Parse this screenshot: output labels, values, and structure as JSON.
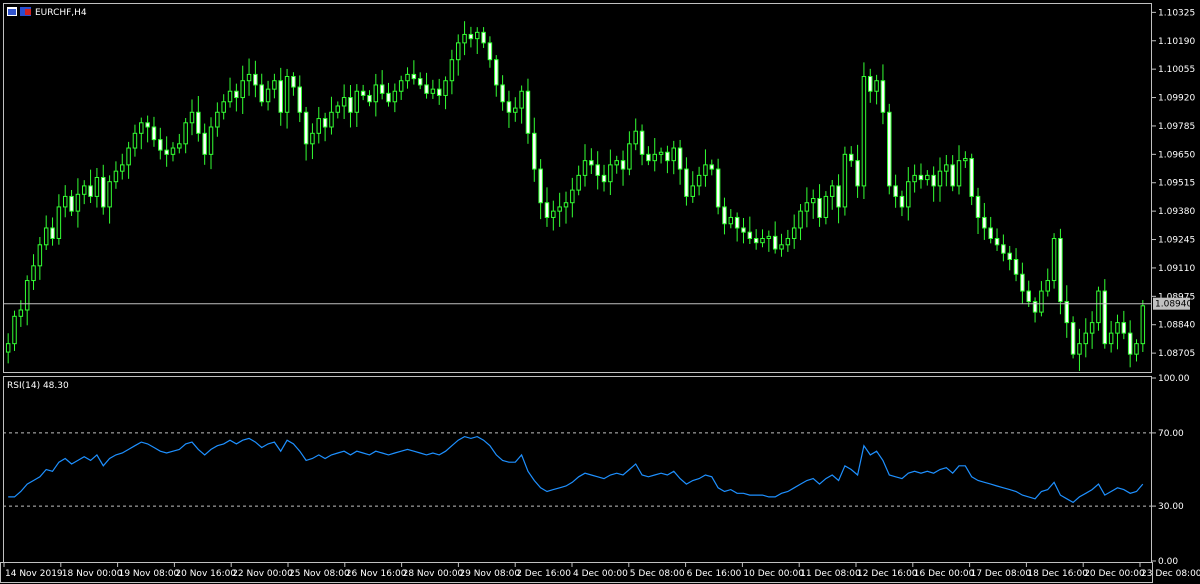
{
  "window": {
    "title": "EURCHF,H4",
    "icon_names": [
      "chart-window-icon",
      "eu-ch-flag-icon"
    ]
  },
  "colors": {
    "background": "#000000",
    "frame": "#c0c0c0",
    "candle_bull": "#ffffff",
    "candle_bear": "#33ff33",
    "wick": "#33ff33",
    "rsi_line": "#1e90ff",
    "current_price_line": "#c0c0c0",
    "level_line": "#c0c0c0"
  },
  "chart_data": [
    {
      "type": "candlestick",
      "symbol": "EURCHF",
      "timeframe": "H4",
      "title": "EURCHF,H4",
      "price_axis_ticks": [
        "1.10325",
        "1.10190",
        "1.10055",
        "1.09920",
        "1.09785",
        "1.09650",
        "1.09515",
        "1.09380",
        "1.09245",
        "1.09110",
        "1.08975",
        "1.08840",
        "1.08705"
      ],
      "current_price": "1.08940",
      "ylim": [
        1.0862,
        1.1036
      ],
      "time_axis_labels": [
        "14 Nov 2019",
        "18 Nov 00:00",
        "19 Nov 08:00",
        "20 Nov 16:00",
        "22 Nov 00:00",
        "25 Nov 08:00",
        "26 Nov 16:00",
        "28 Nov 00:00",
        "29 Nov 08:00",
        "2 Dec 16:00",
        "4 Dec 00:00",
        "5 Dec 08:00",
        "6 Dec 16:00",
        "10 Dec 00:00",
        "11 Dec 08:00",
        "12 Dec 16:00",
        "16 Dec 00:00",
        "17 Dec 08:00",
        "18 Dec 16:00",
        "20 Dec 00:00",
        "23 Dec 08:00"
      ],
      "close": [
        1.0875,
        1.0888,
        1.0891,
        1.0905,
        1.0912,
        1.0922,
        1.093,
        1.0925,
        1.094,
        1.0945,
        1.0938,
        1.0946,
        1.095,
        1.0945,
        1.0954,
        1.094,
        1.0952,
        1.0957,
        1.096,
        1.0968,
        1.0975,
        1.098,
        1.0978,
        1.0972,
        1.0967,
        1.0965,
        1.0968,
        1.097,
        1.098,
        1.0985,
        1.0975,
        1.0965,
        1.0978,
        1.0985,
        1.099,
        1.0995,
        1.0992,
        1.1,
        1.1003,
        1.0998,
        1.099,
        1.0996,
        1.1,
        1.0985,
        1.1002,
        1.0997,
        1.0985,
        1.097,
        1.0975,
        1.0982,
        1.0978,
        1.0985,
        1.0988,
        1.0992,
        1.0985,
        1.0995,
        1.0993,
        1.099,
        1.0998,
        1.0994,
        1.099,
        1.0995,
        1.1,
        1.1003,
        1.1001,
        1.0998,
        1.0994,
        1.0996,
        1.0993,
        1.1,
        1.101,
        1.1018,
        1.1022,
        1.102,
        1.1023,
        1.1018,
        1.101,
        1.0998,
        1.099,
        1.0985,
        1.0987,
        1.0995,
        1.0975,
        1.0958,
        1.0942,
        1.0935,
        1.0938,
        1.094,
        1.0942,
        1.0948,
        1.0955,
        1.0962,
        1.096,
        1.0955,
        1.0952,
        1.096,
        1.0962,
        1.0958,
        1.097,
        1.0976,
        1.0965,
        1.0962,
        1.0965,
        1.0966,
        1.0962,
        1.0968,
        1.0958,
        1.0945,
        1.095,
        1.0955,
        1.096,
        1.0958,
        1.094,
        1.0932,
        1.0935,
        1.093,
        1.0928,
        1.0925,
        1.0923,
        1.0925,
        1.0926,
        1.092,
        1.0922,
        1.0925,
        1.093,
        1.0938,
        1.0942,
        1.0944,
        1.0935,
        1.0945,
        1.095,
        1.094,
        1.0965,
        1.0962,
        1.095,
        1.1002,
        1.0995,
        1.1,
        1.0985,
        1.095,
        1.0945,
        1.094,
        1.0952,
        1.0955,
        1.0953,
        1.0955,
        1.095,
        1.0957,
        1.096,
        1.095,
        1.0962,
        1.0963,
        1.0945,
        1.0935,
        1.093,
        1.0925,
        1.0922,
        1.0918,
        1.0915,
        1.0908,
        1.09,
        1.0895,
        1.089,
        1.09,
        1.0905,
        1.0925,
        1.0895,
        1.0885,
        1.087,
        1.0875,
        1.088,
        1.0885,
        1.09,
        1.0875,
        1.088,
        1.0885,
        1.088,
        1.087,
        1.0875,
        1.0893
      ],
      "rsi": {
        "label": "RSI(14) 48.30",
        "period": 14,
        "last_value": 48.3,
        "axis_ticks": [
          "100.00",
          "70.00",
          "30.00",
          "0.00"
        ],
        "levels": [
          70,
          30
        ],
        "ylim": [
          0,
          100
        ],
        "values": [
          35,
          35,
          38,
          42,
          44,
          46,
          50,
          49,
          54,
          56,
          53,
          55,
          57,
          55,
          58,
          52,
          56,
          58,
          59,
          61,
          63,
          65,
          64,
          62,
          60,
          59,
          60,
          61,
          64,
          65,
          61,
          58,
          61,
          63,
          64,
          66,
          64,
          66,
          67,
          65,
          62,
          64,
          65,
          60,
          66,
          64,
          60,
          55,
          56,
          58,
          56,
          58,
          59,
          60,
          58,
          60,
          59,
          58,
          60,
          59,
          58,
          59,
          60,
          61,
          60,
          59,
          58,
          59,
          58,
          60,
          63,
          66,
          68,
          67,
          68,
          66,
          63,
          58,
          55,
          54,
          54,
          58,
          49,
          44,
          40,
          38,
          39,
          40,
          41,
          43,
          46,
          48,
          47,
          46,
          45,
          47,
          48,
          47,
          50,
          53,
          47,
          46,
          47,
          48,
          47,
          49,
          45,
          42,
          44,
          45,
          47,
          46,
          40,
          38,
          39,
          37,
          37,
          36,
          36,
          36,
          35,
          35,
          37,
          38,
          40,
          42,
          44,
          45,
          42,
          45,
          47,
          44,
          52,
          50,
          47,
          63,
          58,
          60,
          55,
          47,
          46,
          45,
          48,
          49,
          48,
          49,
          48,
          50,
          51,
          48,
          52,
          52,
          46,
          44,
          43,
          42,
          41,
          40,
          39,
          38,
          36,
          35,
          34,
          38,
          39,
          43,
          36,
          34,
          32,
          35,
          37,
          39,
          42,
          36,
          38,
          40,
          39,
          37,
          38,
          42
        ]
      }
    }
  ]
}
